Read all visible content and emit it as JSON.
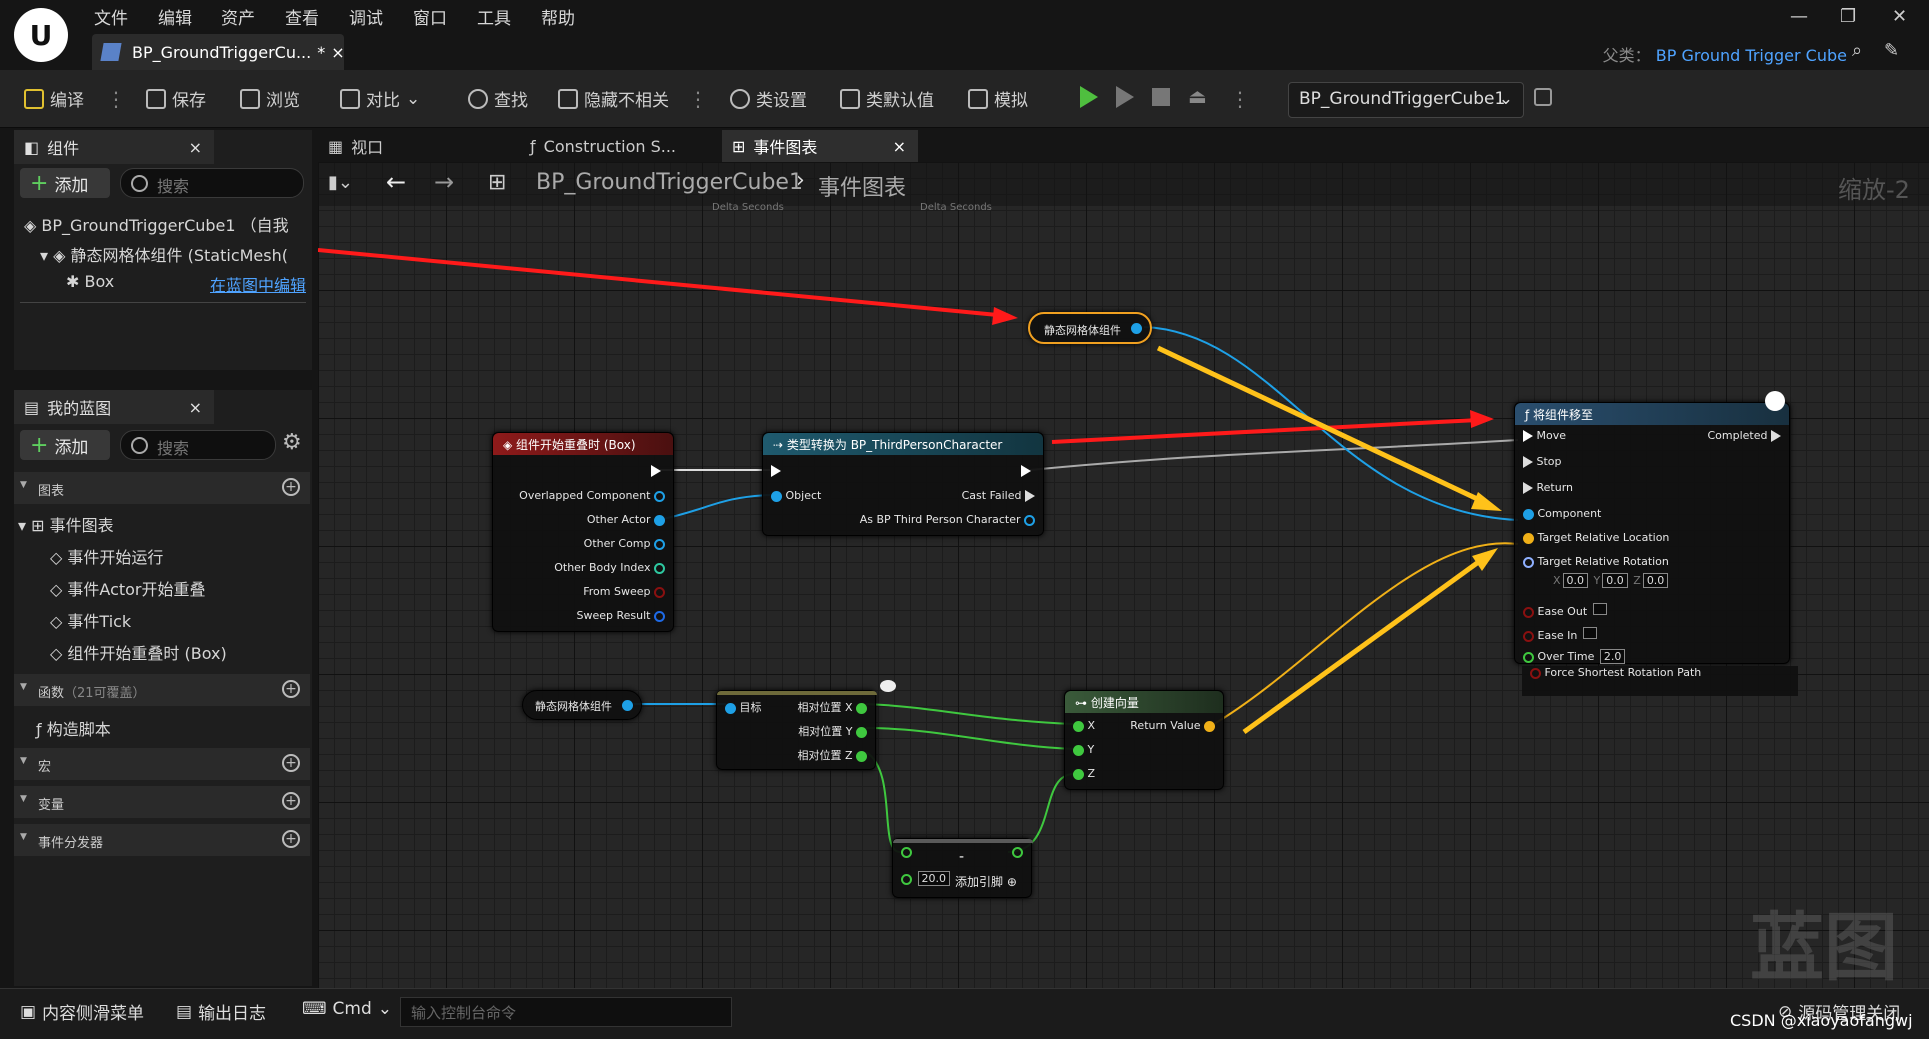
{
  "menu": [
    "文件",
    "编辑",
    "资产",
    "查看",
    "调试",
    "窗口",
    "工具",
    "帮助"
  ],
  "document_tab": {
    "title": "BP_GroundTriggerCu...",
    "modified": "*",
    "close": "×"
  },
  "parent": {
    "label": "父类：",
    "value": "BP Ground Trigger Cube"
  },
  "toolbar": {
    "compile": "编译",
    "save": "保存",
    "browse": "浏览",
    "diff": "对比",
    "find": "查找",
    "hide_unrelated": "隐藏不相关",
    "class_settings": "类设置",
    "class_defaults": "类默认值",
    "simulate": "模拟",
    "debug_object": "BP_GroundTriggerCube1"
  },
  "components_panel": {
    "tab": "组件",
    "close": "×",
    "add": "添加",
    "search_placeholder": "搜索",
    "root": "BP_GroundTriggerCube1 （自我",
    "child": "静态网格体组件 (StaticMesh(",
    "leaf": "Box",
    "edit_link": "在蓝图中编辑"
  },
  "my_blueprint": {
    "tab": "我的蓝图",
    "close": "×",
    "add": "添加",
    "search_placeholder": "搜索",
    "graphs_cat": "图表",
    "event_graph": "事件图表",
    "events": [
      "事件开始运行",
      "事件Actor开始重叠",
      "事件Tick",
      "组件开始重叠时 (Box)"
    ],
    "functions_cat": "函数",
    "functions_note": "（21可覆盖）",
    "construction": "构造脚本",
    "macros_cat": "宏",
    "variables_cat": "变量",
    "dispatchers_cat": "事件分发器"
  },
  "graph_tabs": {
    "viewport": "视口",
    "construction": "Construction S...",
    "event_graph": "事件图表",
    "close": "×"
  },
  "breadcrumb": {
    "bp": "BP_GroundTriggerCube1",
    "graph": "事件图表",
    "zoom": "缩放-2"
  },
  "ghost_pins": [
    "Delta Seconds",
    "Delta Seconds"
  ],
  "nodes": {
    "static_mesh_ref_1": "静态网格体组件",
    "overlap": {
      "title": "组件开始重叠时 (Box)",
      "pins": [
        "Overlapped Component",
        "Other Actor",
        "Other Comp",
        "Other Body Index",
        "From Sweep",
        "Sweep Result"
      ]
    },
    "cast": {
      "title": "类型转换为 BP_ThirdPersonCharacter",
      "object": "Object",
      "failed": "Cast Failed",
      "as": "As BP Third Person Character"
    },
    "move": {
      "title": "将组件移至",
      "inputs": [
        "Move",
        "Stop",
        "Return",
        "Component",
        "Target Relative Location",
        "Target Relative Rotation"
      ],
      "completed": "Completed",
      "rot": {
        "x": "0.0",
        "y": "0.0",
        "z": "0.0"
      },
      "ease_out": "Ease Out",
      "ease_in": "Ease In",
      "over_time": "Over Time",
      "over_time_val": "2.0",
      "force": "Force Shortest Rotation Path"
    },
    "static_mesh_ref_2": "静态网格体组件",
    "get_loc": {
      "target": "目标",
      "x": "相对位置 X",
      "y": "相对位置 Y",
      "z": "相对位置 Z"
    },
    "make_vec": {
      "title": "创建向量",
      "x": "X",
      "y": "Y",
      "z": "Z",
      "ret": "Return Value"
    },
    "subtract": {
      "op": "-",
      "val": "20.0",
      "add_pin": "添加引脚"
    }
  },
  "watermark": "蓝图",
  "bottom": {
    "content_drawer": "内容侧滑菜单",
    "output_log": "输出日志",
    "cmd": "Cmd",
    "cmd_placeholder": "输入控制台命令",
    "source_control": "源码管理关闭",
    "csdn": "CSDN @xiaoyaofangwj"
  },
  "colors": {
    "accent_blue": "#4fa3ff",
    "red_arrow": "#ff1a1a",
    "yellow_arrow": "#ffc21a",
    "event_header": "#8e1a1a",
    "cast_header": "#1f5a6e",
    "func_header": "#2a4e6e",
    "pure_header": "#3a5a3a"
  }
}
